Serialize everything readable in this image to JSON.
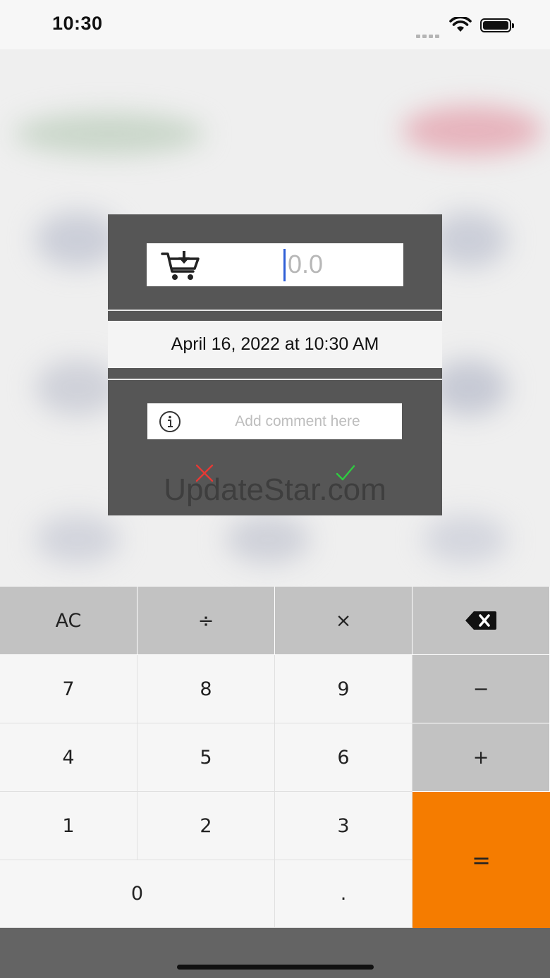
{
  "status_bar": {
    "time": "10:30"
  },
  "dialog": {
    "amount": {
      "value": "",
      "placeholder": "0.0"
    },
    "date": "April 16, 2022 at 10:30 AM",
    "comment": {
      "value": "",
      "placeholder": "Add comment here"
    },
    "watermark": "UpdateStar.com",
    "colors": {
      "cancel": "#e53935",
      "confirm": "#2ecc40",
      "panel": "#565656"
    }
  },
  "keypad": {
    "clear": "AC",
    "divide": "÷",
    "multiply": "×",
    "minus": "−",
    "plus": "+",
    "equals": "=",
    "seven": "7",
    "eight": "8",
    "nine": "9",
    "four": "4",
    "five": "5",
    "six": "6",
    "one": "1",
    "two": "2",
    "three": "3",
    "zero": "0",
    "decimal": ".",
    "accent_color": "#f57c00"
  }
}
